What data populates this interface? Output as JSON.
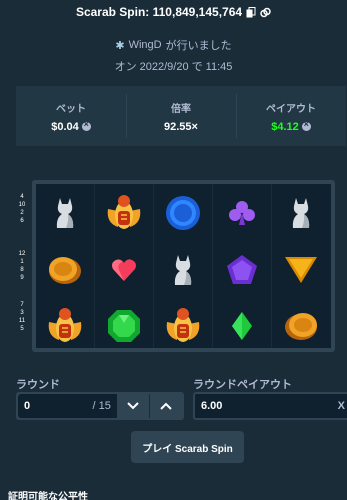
{
  "header": {
    "title": "Scarab Spin: 110,849,145,764",
    "copy_icon": "copy-icon",
    "link_icon": "link-icon"
  },
  "player": {
    "icon": "star-icon",
    "name": "WingD",
    "suffix": "が行いました"
  },
  "date_line": "オン 2022/9/20 で 11:45",
  "stats": {
    "bet_label": "ベット",
    "bet_value": "$0.04",
    "multiplier_label": "倍率",
    "multiplier_value": "92.55×",
    "payout_label": "ペイアウト",
    "payout_value": "$4.12",
    "payout_color": "#1fff20",
    "currency_icon": "coin-icon"
  },
  "paylines": {
    "row1": [
      "4",
      "10",
      "2",
      "6"
    ],
    "row2": [
      "12",
      "1",
      "8",
      "9"
    ],
    "row3": [
      "7",
      "3",
      "11",
      "5"
    ]
  },
  "reels": [
    [
      "cat-statue",
      "golden-scarab",
      "golden-coin"
    ],
    [
      "golden-scarab",
      "red-heart",
      "green-gem"
    ],
    [
      "blue-orb",
      "cat-statue",
      "golden-scarab"
    ],
    [
      "purple-club",
      "purple-pentagon",
      "green-diamond"
    ],
    [
      "cat-statue",
      "orange-triangle",
      "golden-coin"
    ]
  ],
  "round": {
    "label": "ラウンド",
    "value": "0",
    "max": "/ 15"
  },
  "round_payout": {
    "label": "ラウンドペイアウト",
    "value": "6.00",
    "suffix": "X"
  },
  "play_button": "プレイ Scarab Spin",
  "fairness_heading": "証明可能な公平性"
}
